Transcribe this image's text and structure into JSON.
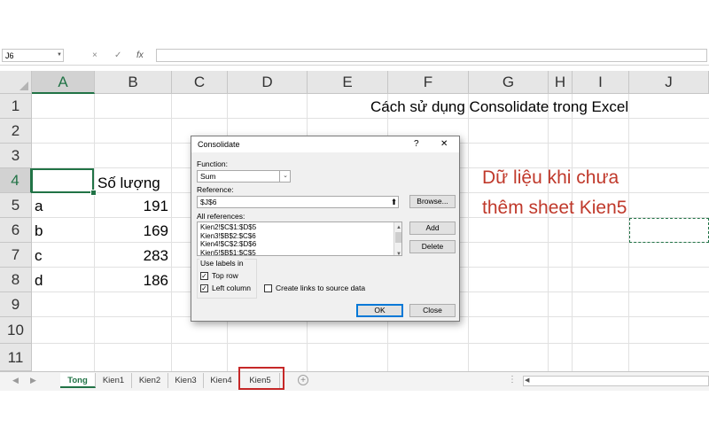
{
  "formula_bar": {
    "name_box": "J6",
    "cancel_icon": "×",
    "enter_icon": "✓",
    "fx_label": "fx",
    "formula": ""
  },
  "columns": [
    "A",
    "B",
    "C",
    "D",
    "E",
    "F",
    "G",
    "H",
    "I",
    "J"
  ],
  "rows": [
    "1",
    "2",
    "3",
    "4",
    "5",
    "6",
    "7",
    "8",
    "9",
    "10",
    "11"
  ],
  "cells": {
    "title": "Cách sử dụng Consolidate trong Excel",
    "header_b4": "Số lượng",
    "data": [
      {
        "label": "a",
        "value": "191"
      },
      {
        "label": "b",
        "value": "169"
      },
      {
        "label": "c",
        "value": "283"
      },
      {
        "label": "d",
        "value": "186"
      }
    ]
  },
  "annotation": {
    "line1": "Dữ liệu khi chưa",
    "line2": "thêm sheet Kien5",
    "color": "#c0392b"
  },
  "dialog": {
    "title": "Consolidate",
    "help": "?",
    "close": "✕",
    "function_label": "Function:",
    "function_value": "Sum",
    "reference_label": "Reference:",
    "reference_value": "$J$6",
    "browse_button": "Browse...",
    "all_references_label": "All references:",
    "all_references": [
      "Kien2!$C$1:$D$5",
      "Kien3!$B$2:$C$6",
      "Kien4!$C$2:$D$6",
      "Kien5!$B$1:$C$5"
    ],
    "add_button": "Add",
    "delete_button": "Delete",
    "use_labels_label": "Use labels in",
    "top_row_label": "Top row",
    "top_row_checked": true,
    "left_column_label": "Left column",
    "left_column_checked": true,
    "create_links_label": "Create links to source data",
    "create_links_checked": false,
    "ok_button": "OK",
    "close_button": "Close"
  },
  "sheet_tabs": [
    "Tong",
    "Kien1",
    "Kien2",
    "Kien3",
    "Kien4",
    "Kien5"
  ],
  "active_sheet": "Tong",
  "colors": {
    "excel_green": "#217346",
    "highlight_red": "#c62828"
  }
}
